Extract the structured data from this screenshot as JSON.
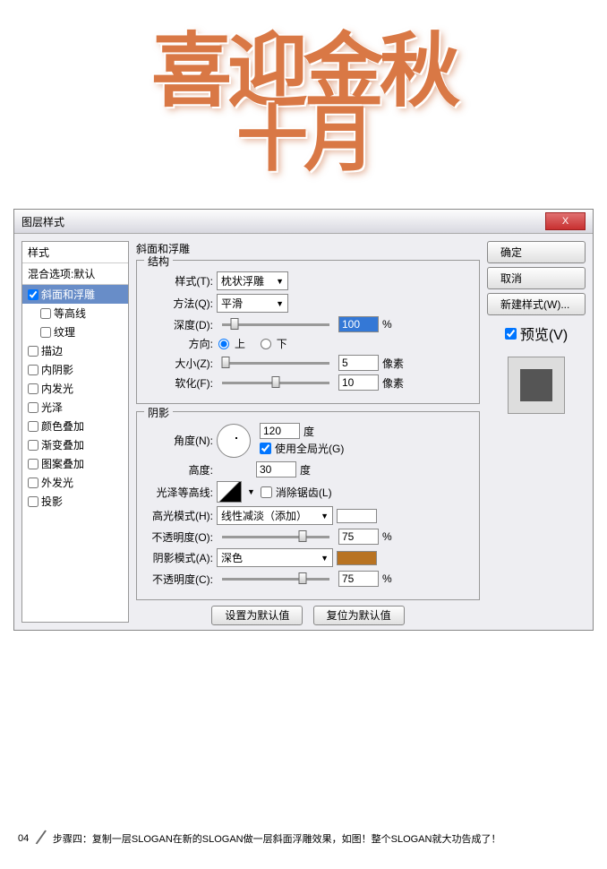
{
  "artwork": {
    "line1": "喜迎金秋",
    "line2": "十月"
  },
  "dialog": {
    "title": "图层样式",
    "close": "X",
    "styles": {
      "header": "样式",
      "blend": "混合选项:默认",
      "items": [
        {
          "label": "斜面和浮雕",
          "checked": true,
          "selected": true,
          "sub": false
        },
        {
          "label": "等高线",
          "checked": false,
          "selected": false,
          "sub": true
        },
        {
          "label": "纹理",
          "checked": false,
          "selected": false,
          "sub": true
        },
        {
          "label": "描边",
          "checked": false,
          "selected": false,
          "sub": false
        },
        {
          "label": "内阴影",
          "checked": false,
          "selected": false,
          "sub": false
        },
        {
          "label": "内发光",
          "checked": false,
          "selected": false,
          "sub": false
        },
        {
          "label": "光泽",
          "checked": false,
          "selected": false,
          "sub": false
        },
        {
          "label": "颜色叠加",
          "checked": false,
          "selected": false,
          "sub": false
        },
        {
          "label": "渐变叠加",
          "checked": false,
          "selected": false,
          "sub": false
        },
        {
          "label": "图案叠加",
          "checked": false,
          "selected": false,
          "sub": false
        },
        {
          "label": "外发光",
          "checked": false,
          "selected": false,
          "sub": false
        },
        {
          "label": "投影",
          "checked": false,
          "selected": false,
          "sub": false
        }
      ]
    },
    "main_title": "斜面和浮雕",
    "structure": {
      "legend": "结构",
      "style_label": "样式(T):",
      "style_value": "枕状浮雕",
      "method_label": "方法(Q):",
      "method_value": "平滑",
      "depth_label": "深度(D):",
      "depth_value": "100",
      "depth_unit": "%",
      "dir_label": "方向:",
      "dir_up": "上",
      "dir_down": "下",
      "size_label": "大小(Z):",
      "size_value": "5",
      "size_unit": "像素",
      "soften_label": "软化(F):",
      "soften_value": "10",
      "soften_unit": "像素"
    },
    "shading": {
      "legend": "阴影",
      "angle_label": "角度(N):",
      "angle_value": "120",
      "angle_unit": "度",
      "global_label": "使用全局光(G)",
      "alt_label": "高度:",
      "alt_value": "30",
      "alt_unit": "度",
      "gloss_label": "光泽等高线:",
      "antialias_label": "消除锯齿(L)",
      "hilite_mode_label": "高光模式(H):",
      "hilite_mode_value": "线性减淡（添加）",
      "hilite_color": "#ffffff",
      "hilite_op_label": "不透明度(O):",
      "hilite_op_value": "75",
      "hilite_op_unit": "%",
      "shadow_mode_label": "阴影模式(A):",
      "shadow_mode_value": "深色",
      "shadow_color": "#b87322",
      "shadow_op_label": "不透明度(C):",
      "shadow_op_value": "75",
      "shadow_op_unit": "%"
    },
    "defaults": {
      "make": "设置为默认值",
      "reset": "复位为默认值"
    },
    "side": {
      "ok": "确定",
      "cancel": "取消",
      "newstyle": "新建样式(W)...",
      "preview": "预览(V)"
    }
  },
  "footer": {
    "num": "04",
    "text": "步骤四：复制一层SLOGAN在新的SLOGAN做一层斜面浮雕效果，如图！整个SLOGAN就大功告成了！"
  }
}
